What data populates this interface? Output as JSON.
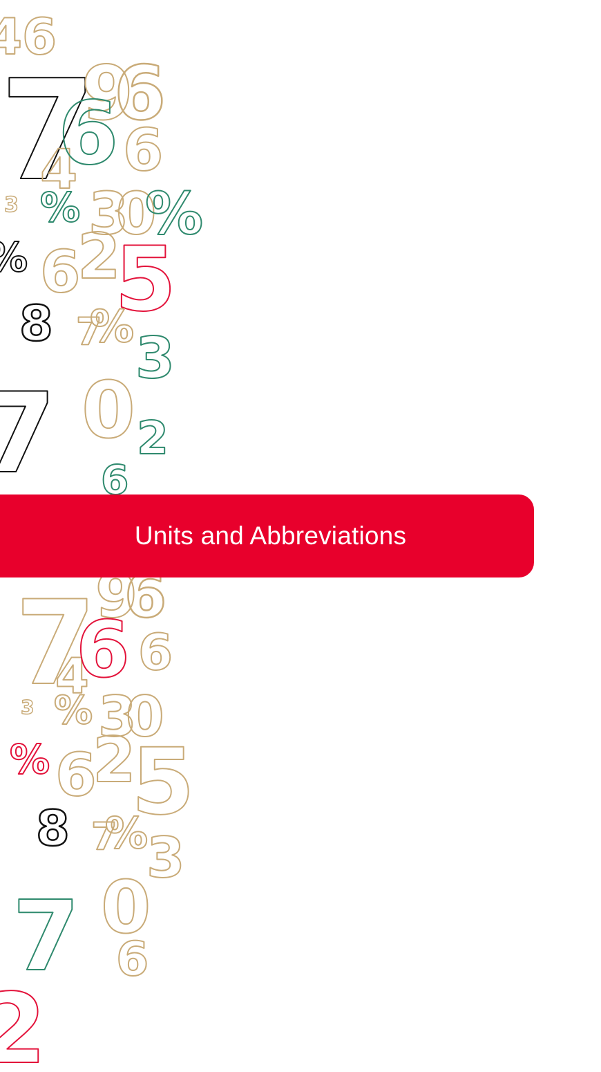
{
  "section": {
    "title": "Units and Abbreviations"
  },
  "colors": {
    "banner": "#e8002c",
    "banner_text": "#ffffff",
    "digit_gold": "#c9ab78",
    "digit_green": "#2f8a6e",
    "digit_red": "#e3133b",
    "digit_black": "#111111"
  },
  "decoration": {
    "name": "outlined-number-pattern",
    "glyphs": [
      "4",
      "6",
      "7",
      "9",
      "6",
      "4",
      "6",
      "6",
      "3",
      "%",
      "3",
      "0",
      "%",
      "%",
      "6",
      "2",
      "5",
      "8",
      "7",
      "%",
      "3",
      "7",
      "0",
      "6",
      "2",
      "7",
      "9",
      "6",
      "4",
      "6",
      "6",
      "3",
      "%",
      "3",
      "0",
      "%",
      "6",
      "2",
      "5",
      "8",
      "7",
      "%",
      "3",
      "7",
      "0",
      "6",
      "2"
    ]
  }
}
